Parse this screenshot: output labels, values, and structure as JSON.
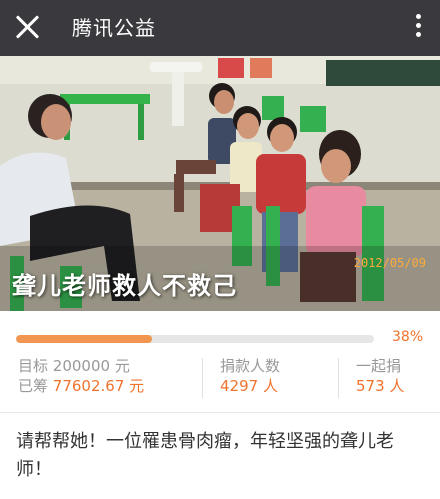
{
  "header": {
    "title": "腾讯公益",
    "close_icon": "close-icon",
    "more_icon": "more-vertical-icon"
  },
  "hero": {
    "title": "聋儿老师救人不救己",
    "photo_date": "2012/05/09"
  },
  "progress": {
    "value": 0.38,
    "percent_label": "38%"
  },
  "stats": {
    "target_label": "目标",
    "target_value": "200000",
    "target_unit": "元",
    "raised_label": "已筹",
    "raised_value": "77602.67",
    "raised_unit": "元",
    "donors_label": "捐款人数",
    "donors_value": "4297",
    "donors_unit": "人",
    "together_label": "一起捐",
    "together_value": "573",
    "together_unit": "人"
  },
  "description": "请帮帮她！一位罹患骨肉瘤，年轻坚强的聋儿老师！",
  "colors": {
    "topbar": "#3a3a3e",
    "accent": "#f0732d",
    "progress_fill": "#f09650"
  }
}
